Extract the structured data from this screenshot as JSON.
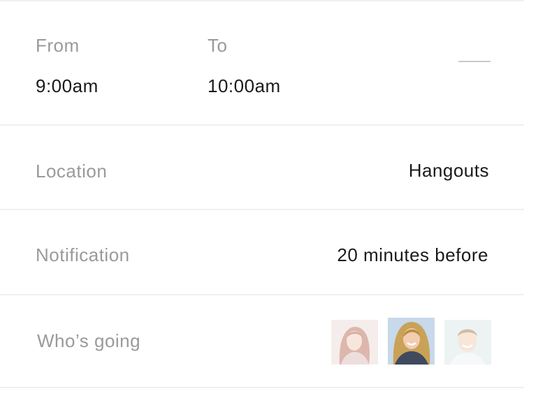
{
  "time": {
    "from_label": "From",
    "from_value": "9:00am",
    "to_label": "To",
    "to_value": "10:00am"
  },
  "location": {
    "label": "Location",
    "value": "Hangouts"
  },
  "notification": {
    "label": "Notification",
    "value": "20 minutes before"
  },
  "attendees": {
    "label": "Who’s going",
    "people": [
      {
        "icon": "avatar-woman-red-hair-icon",
        "opacity": 0.45
      },
      {
        "icon": "avatar-woman-blonde-hair-icon",
        "opacity": 1
      },
      {
        "icon": "avatar-man-smiling-icon",
        "opacity": 0.45
      }
    ]
  }
}
